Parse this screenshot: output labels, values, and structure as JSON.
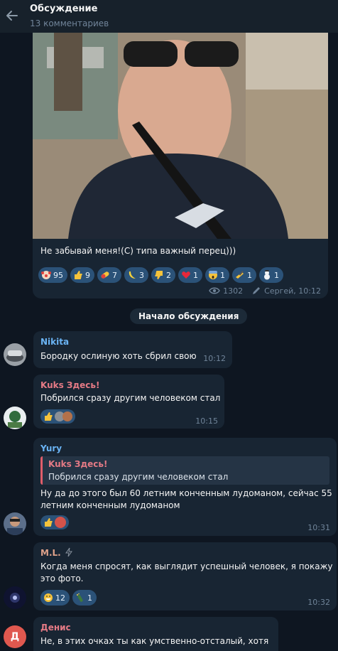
{
  "header": {
    "title": "Обсуждение",
    "subtitle": "13 комментариев"
  },
  "post": {
    "caption": "Не забывай меня!(С) типа важный перец)))",
    "reactions": [
      {
        "icon": "clown-emoji",
        "count": "95"
      },
      {
        "icon": "thumbs-up-emoji",
        "count": "9"
      },
      {
        "icon": "pill-emoji",
        "count": "7"
      },
      {
        "icon": "banana-emoji",
        "count": "3"
      },
      {
        "icon": "thumbs-down-emoji",
        "count": "2"
      },
      {
        "icon": "heart-emoji",
        "count": "1"
      },
      {
        "icon": "scream-emoji",
        "count": "1"
      },
      {
        "icon": "writing-hand-emoji",
        "count": "1"
      },
      {
        "icon": "snowman-emoji",
        "count": "1"
      }
    ],
    "views": "1302",
    "signature": "Сергей, 10:12"
  },
  "divider_label": "Начало обсуждения",
  "comments": [
    {
      "author": "Nikita",
      "author_color": "#6ab3f3",
      "text": "Бородку ослиную хоть сбрил свою",
      "time": "10:12"
    },
    {
      "author": "Kuks Здесь!",
      "author_color": "#e57a85",
      "text": "Побрился сразу другим человеком стал",
      "time": "10:15"
    },
    {
      "author": "Yury",
      "author_color": "#6ab3f3",
      "quote_author": "Kuks Здесь!",
      "quote_text": "Побрился сразу другим человеком стал",
      "text_line1": "Ну да до этого был 60 летним конченным лудоманом, сейчас 55",
      "text_line2": "летним конченным лудоманом",
      "time": "10:31"
    },
    {
      "author": "M.L.",
      "author_color": "#dfa28a",
      "text_line1": "Когда меня спросят, как выглядит успешный человек, я покажу",
      "text_line2": "это фото.",
      "reactions": [
        {
          "icon": "grin-emoji",
          "count": "12"
        },
        {
          "icon": "champagne-emoji",
          "count": "1"
        }
      ],
      "time": "10:32"
    },
    {
      "author": "Денис",
      "author_color": "#e57a85",
      "avatar_letter": "Д",
      "text": "Не, в этих очках ты как умственно-отсталый, хотя ...."
    }
  ]
}
